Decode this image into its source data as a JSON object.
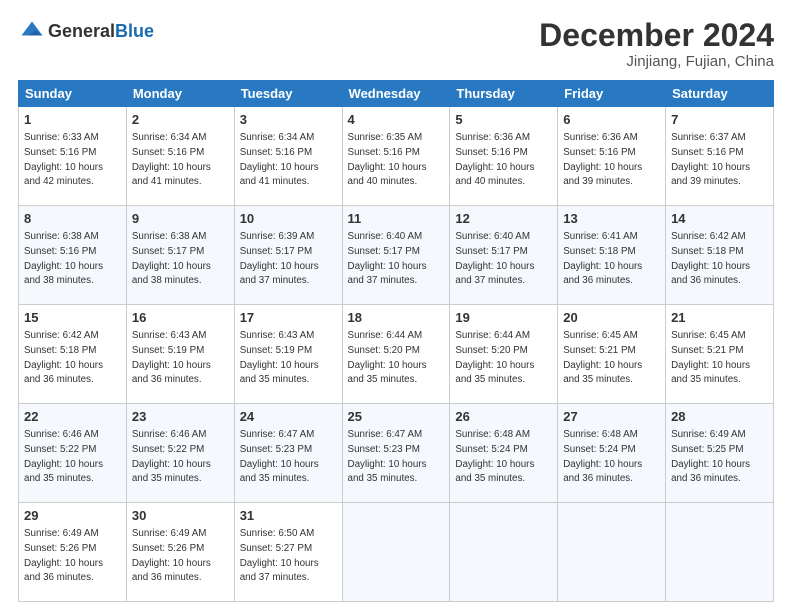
{
  "logo": {
    "general": "General",
    "blue": "Blue"
  },
  "title": {
    "month_year": "December 2024",
    "location": "Jinjiang, Fujian, China"
  },
  "weekdays": [
    "Sunday",
    "Monday",
    "Tuesday",
    "Wednesday",
    "Thursday",
    "Friday",
    "Saturday"
  ],
  "weeks": [
    [
      {
        "day": "1",
        "sunrise": "6:33 AM",
        "sunset": "5:16 PM",
        "daylight": "10 hours and 42 minutes."
      },
      {
        "day": "2",
        "sunrise": "6:34 AM",
        "sunset": "5:16 PM",
        "daylight": "10 hours and 41 minutes."
      },
      {
        "day": "3",
        "sunrise": "6:34 AM",
        "sunset": "5:16 PM",
        "daylight": "10 hours and 41 minutes."
      },
      {
        "day": "4",
        "sunrise": "6:35 AM",
        "sunset": "5:16 PM",
        "daylight": "10 hours and 40 minutes."
      },
      {
        "day": "5",
        "sunrise": "6:36 AM",
        "sunset": "5:16 PM",
        "daylight": "10 hours and 40 minutes."
      },
      {
        "day": "6",
        "sunrise": "6:36 AM",
        "sunset": "5:16 PM",
        "daylight": "10 hours and 39 minutes."
      },
      {
        "day": "7",
        "sunrise": "6:37 AM",
        "sunset": "5:16 PM",
        "daylight": "10 hours and 39 minutes."
      }
    ],
    [
      {
        "day": "8",
        "sunrise": "6:38 AM",
        "sunset": "5:16 PM",
        "daylight": "10 hours and 38 minutes."
      },
      {
        "day": "9",
        "sunrise": "6:38 AM",
        "sunset": "5:17 PM",
        "daylight": "10 hours and 38 minutes."
      },
      {
        "day": "10",
        "sunrise": "6:39 AM",
        "sunset": "5:17 PM",
        "daylight": "10 hours and 37 minutes."
      },
      {
        "day": "11",
        "sunrise": "6:40 AM",
        "sunset": "5:17 PM",
        "daylight": "10 hours and 37 minutes."
      },
      {
        "day": "12",
        "sunrise": "6:40 AM",
        "sunset": "5:17 PM",
        "daylight": "10 hours and 37 minutes."
      },
      {
        "day": "13",
        "sunrise": "6:41 AM",
        "sunset": "5:18 PM",
        "daylight": "10 hours and 36 minutes."
      },
      {
        "day": "14",
        "sunrise": "6:42 AM",
        "sunset": "5:18 PM",
        "daylight": "10 hours and 36 minutes."
      }
    ],
    [
      {
        "day": "15",
        "sunrise": "6:42 AM",
        "sunset": "5:18 PM",
        "daylight": "10 hours and 36 minutes."
      },
      {
        "day": "16",
        "sunrise": "6:43 AM",
        "sunset": "5:19 PM",
        "daylight": "10 hours and 36 minutes."
      },
      {
        "day": "17",
        "sunrise": "6:43 AM",
        "sunset": "5:19 PM",
        "daylight": "10 hours and 35 minutes."
      },
      {
        "day": "18",
        "sunrise": "6:44 AM",
        "sunset": "5:20 PM",
        "daylight": "10 hours and 35 minutes."
      },
      {
        "day": "19",
        "sunrise": "6:44 AM",
        "sunset": "5:20 PM",
        "daylight": "10 hours and 35 minutes."
      },
      {
        "day": "20",
        "sunrise": "6:45 AM",
        "sunset": "5:21 PM",
        "daylight": "10 hours and 35 minutes."
      },
      {
        "day": "21",
        "sunrise": "6:45 AM",
        "sunset": "5:21 PM",
        "daylight": "10 hours and 35 minutes."
      }
    ],
    [
      {
        "day": "22",
        "sunrise": "6:46 AM",
        "sunset": "5:22 PM",
        "daylight": "10 hours and 35 minutes."
      },
      {
        "day": "23",
        "sunrise": "6:46 AM",
        "sunset": "5:22 PM",
        "daylight": "10 hours and 35 minutes."
      },
      {
        "day": "24",
        "sunrise": "6:47 AM",
        "sunset": "5:23 PM",
        "daylight": "10 hours and 35 minutes."
      },
      {
        "day": "25",
        "sunrise": "6:47 AM",
        "sunset": "5:23 PM",
        "daylight": "10 hours and 35 minutes."
      },
      {
        "day": "26",
        "sunrise": "6:48 AM",
        "sunset": "5:24 PM",
        "daylight": "10 hours and 35 minutes."
      },
      {
        "day": "27",
        "sunrise": "6:48 AM",
        "sunset": "5:24 PM",
        "daylight": "10 hours and 36 minutes."
      },
      {
        "day": "28",
        "sunrise": "6:49 AM",
        "sunset": "5:25 PM",
        "daylight": "10 hours and 36 minutes."
      }
    ],
    [
      {
        "day": "29",
        "sunrise": "6:49 AM",
        "sunset": "5:26 PM",
        "daylight": "10 hours and 36 minutes."
      },
      {
        "day": "30",
        "sunrise": "6:49 AM",
        "sunset": "5:26 PM",
        "daylight": "10 hours and 36 minutes."
      },
      {
        "day": "31",
        "sunrise": "6:50 AM",
        "sunset": "5:27 PM",
        "daylight": "10 hours and 37 minutes."
      },
      null,
      null,
      null,
      null
    ]
  ],
  "labels": {
    "sunrise": "Sunrise:",
    "sunset": "Sunset:",
    "daylight": "Daylight:"
  }
}
